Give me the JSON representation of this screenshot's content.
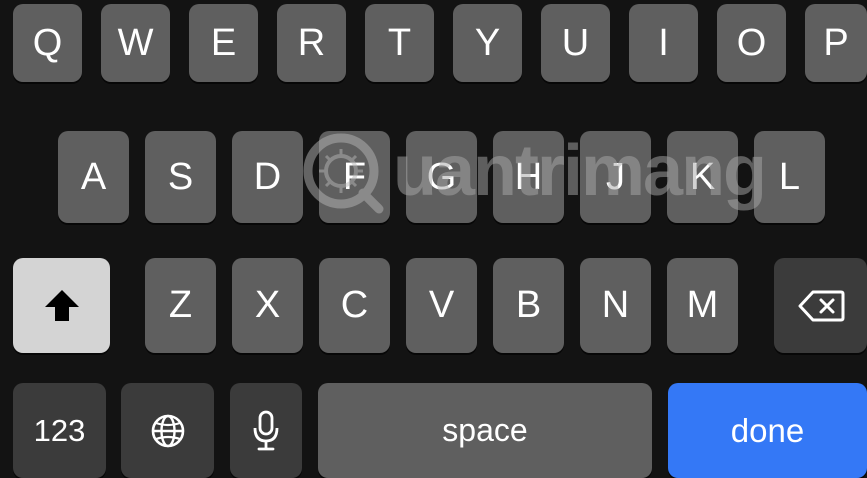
{
  "keyboard": {
    "row1": [
      "Q",
      "W",
      "E",
      "R",
      "T",
      "Y",
      "U",
      "I",
      "O",
      "P"
    ],
    "row2": [
      "A",
      "S",
      "D",
      "F",
      "G",
      "H",
      "J",
      "K",
      "L"
    ],
    "row3": [
      "Z",
      "X",
      "C",
      "V",
      "B",
      "N",
      "M"
    ],
    "numbers_label": "123",
    "space_label": "space",
    "done_label": "done",
    "shift_icon": "shift-icon",
    "delete_icon": "delete-backspace-icon",
    "globe_icon": "globe-icon",
    "mic_icon": "microphone-icon"
  },
  "watermark": {
    "text": "uantrimang",
    "logo_icon": "quantrimang-logo-icon"
  },
  "colors": {
    "key": "#5f5f5f",
    "key_dark": "#3b3b3b",
    "shift_active": "#d4d4d4",
    "done_blue": "#3478f6",
    "background": "#131313"
  }
}
